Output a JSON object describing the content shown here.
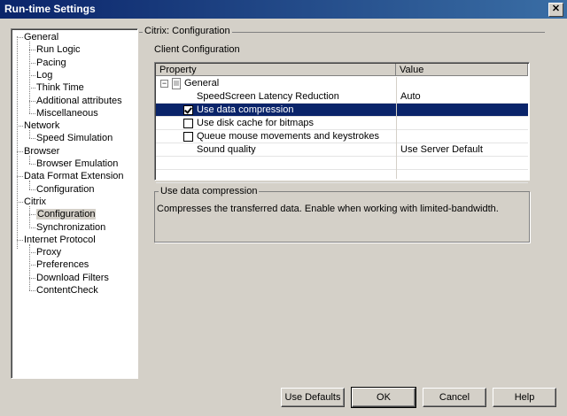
{
  "window": {
    "title": "Run-time Settings",
    "close_glyph": "✕"
  },
  "tree": {
    "items": [
      {
        "label": "General",
        "level": 0
      },
      {
        "label": "Run Logic",
        "level": 1
      },
      {
        "label": "Pacing",
        "level": 1
      },
      {
        "label": "Log",
        "level": 1
      },
      {
        "label": "Think Time",
        "level": 1
      },
      {
        "label": "Additional attributes",
        "level": 1
      },
      {
        "label": "Miscellaneous",
        "level": 1
      },
      {
        "label": "Network",
        "level": 0
      },
      {
        "label": "Speed Simulation",
        "level": 1
      },
      {
        "label": "Browser",
        "level": 0
      },
      {
        "label": "Browser Emulation",
        "level": 1
      },
      {
        "label": "Data Format Extension",
        "level": 0
      },
      {
        "label": "Configuration",
        "level": 1
      },
      {
        "label": "Citrix",
        "level": 0
      },
      {
        "label": "Configuration",
        "level": 1,
        "selected": true
      },
      {
        "label": "Synchronization",
        "level": 1
      },
      {
        "label": "Internet Protocol",
        "level": 0
      },
      {
        "label": "Proxy",
        "level": 1
      },
      {
        "label": "Preferences",
        "level": 1
      },
      {
        "label": "Download Filters",
        "level": 1
      },
      {
        "label": "ContentCheck",
        "level": 1
      }
    ]
  },
  "section": {
    "title": "Citrix: Configuration",
    "subtitle": "Client Configuration"
  },
  "grid": {
    "col_property": "Property",
    "col_value": "Value",
    "group_label": "General",
    "group_expander": "−",
    "rows": [
      {
        "property": "SpeedScreen Latency Reduction",
        "value": "Auto",
        "checkbox": null
      },
      {
        "property": "Use data compression",
        "value": "",
        "checkbox": true,
        "selected": true
      },
      {
        "property": "Use disk cache for bitmaps",
        "value": "",
        "checkbox": false
      },
      {
        "property": "Queue mouse movements and keystrokes",
        "value": "",
        "checkbox": false
      },
      {
        "property": "Sound quality",
        "value": "Use Server Default",
        "checkbox": null
      }
    ]
  },
  "description": {
    "title": "Use data compression",
    "text": "Compresses the transferred data. Enable when working with limited-bandwidth."
  },
  "buttons": {
    "use_defaults": "Use Defaults",
    "ok": "OK",
    "cancel": "Cancel",
    "help": "Help"
  }
}
